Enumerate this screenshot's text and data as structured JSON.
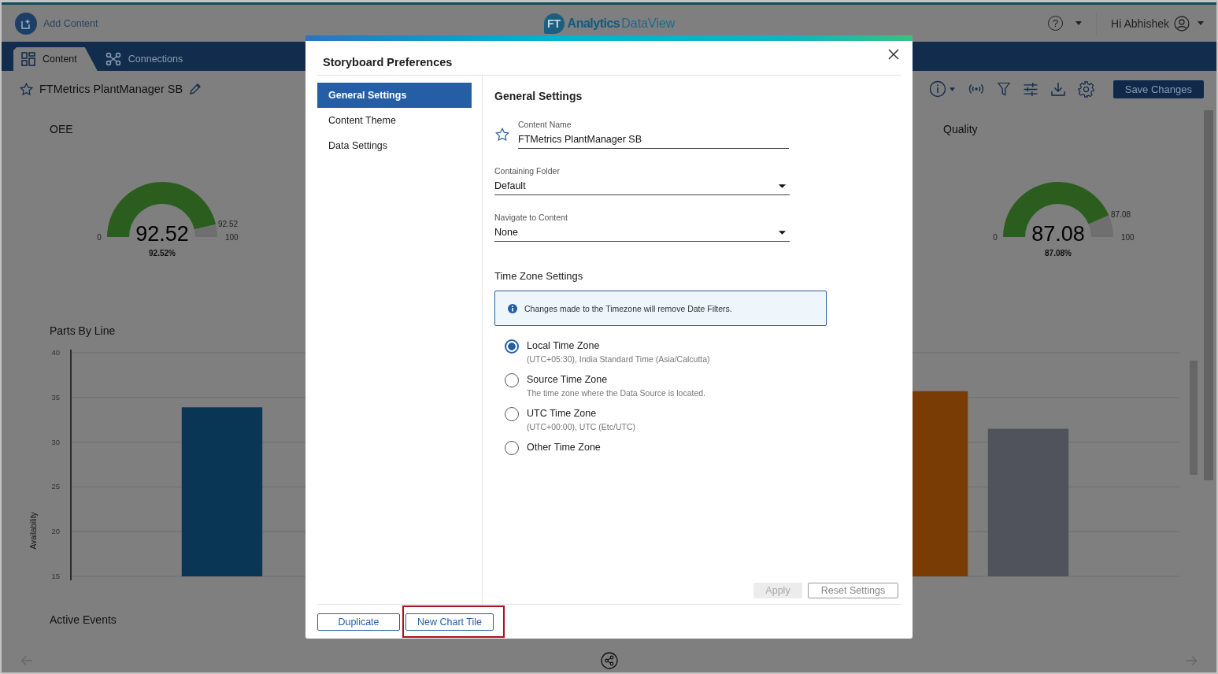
{
  "header": {
    "add_content": "Add Content",
    "logo_badge": "FT",
    "brand": "Analytics",
    "product": "DataView",
    "help_glyph": "?",
    "greeting": "Hi Abhishek"
  },
  "tabs": [
    {
      "label": "Content",
      "selected": true
    },
    {
      "label": "Connections",
      "selected": false
    }
  ],
  "storyboard": {
    "title": "FTMetrics PlantManager SB",
    "favorite": false,
    "save_button": "Save Changes"
  },
  "gauges": [
    {
      "title": "OEE",
      "value": "92.52",
      "percent": "92.52%",
      "min": "0",
      "max": "100",
      "marker": "92.52"
    },
    {
      "title": "Quality",
      "value": "87.08",
      "percent": "87.08%",
      "min": "0",
      "max": "100",
      "marker": "87.08"
    }
  ],
  "parts_chart": {
    "title": "Parts By Line",
    "chart_data": {
      "type": "bar",
      "grid": true,
      "ylabel": "Availability",
      "values": [
        null,
        33.9,
        null,
        null,
        null,
        null,
        null,
        null,
        35.7,
        31.5,
        null
      ],
      "ylim": [
        15,
        40
      ],
      "yticks": [
        15,
        20,
        25,
        30,
        35,
        40
      ]
    }
  },
  "active_events": {
    "title": "Active Events"
  },
  "dialog": {
    "title": "Storyboard Preferences",
    "nav": [
      {
        "label": "General Settings",
        "selected": true
      },
      {
        "label": "Content Theme",
        "selected": false
      },
      {
        "label": "Data Settings",
        "selected": false
      }
    ],
    "section_title": "General Settings",
    "fields": [
      {
        "kind": "text",
        "label": "Content Name",
        "value": "FTMetrics PlantManager SB",
        "favorite": false
      },
      {
        "kind": "select",
        "label": "Containing Folder",
        "value": "Default"
      },
      {
        "kind": "select",
        "label": "Navigate to Content",
        "value": "None"
      }
    ],
    "timezone": {
      "title": "Time Zone Settings",
      "notice": "Changes made to the Timezone will remove Date Filters.",
      "options": [
        {
          "label": "Local Time Zone",
          "detail": "(UTC+05:30), India Standard Time (Asia/Calcutta)",
          "selected": true
        },
        {
          "label": "Source Time Zone",
          "detail": "The time zone where the Data Source is located.",
          "selected": false
        },
        {
          "label": "UTC Time Zone",
          "detail": "(UTC+00:00), UTC (Etc/UTC)",
          "selected": false
        },
        {
          "label": "Other Time Zone",
          "selected": false
        }
      ]
    },
    "apply": {
      "label": "Apply",
      "disabled": true
    },
    "reset": "Reset Settings",
    "footer_buttons": [
      {
        "label": "Duplicate",
        "highlighted": false
      },
      {
        "label": "New Chart Tile",
        "highlighted": true
      }
    ]
  }
}
